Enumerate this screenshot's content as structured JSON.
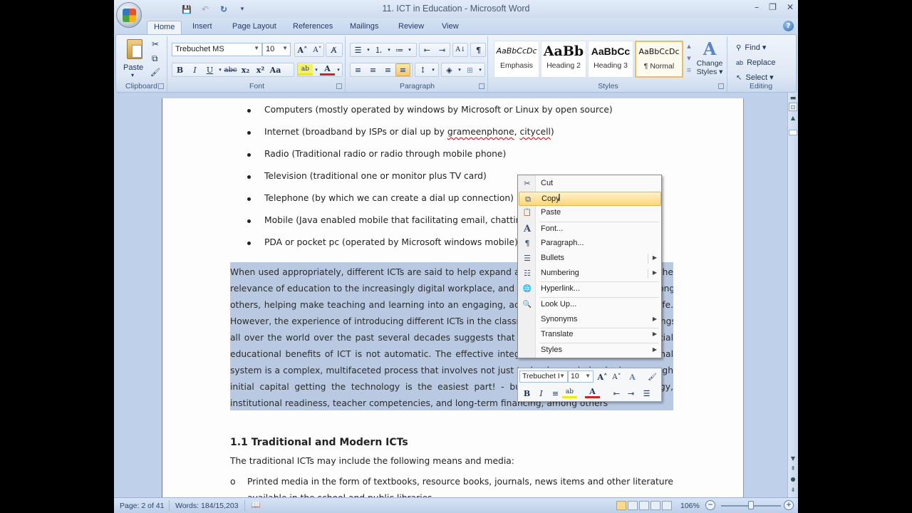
{
  "window": {
    "title": "11. ICT in Education - Microsoft Word",
    "controls": {
      "minimize": "–",
      "restore": "❐",
      "close": "✕"
    }
  },
  "quick_access": {
    "save": "💾",
    "undo": "↶",
    "redo": "↻",
    "customize": "▾"
  },
  "tabs": [
    {
      "label": "Home",
      "active": true
    },
    {
      "label": "Insert"
    },
    {
      "label": "Page Layout"
    },
    {
      "label": "References"
    },
    {
      "label": "Mailings"
    },
    {
      "label": "Review"
    },
    {
      "label": "View"
    }
  ],
  "help": "?",
  "ribbon": {
    "clipboard": {
      "label": "Clipboard",
      "paste": "Paste",
      "paste_arrow": "▾",
      "cut": "✂",
      "copy": "⧉",
      "format_painter": "🖌"
    },
    "font": {
      "label": "Font",
      "name": "Trebuchet MS",
      "size": "10",
      "grow": "A˄",
      "shrink": "A˅",
      "clear": "A̸",
      "bold": "B",
      "italic": "I",
      "underline": "U",
      "strike": "abc",
      "subscript": "x₂",
      "superscript": "x²",
      "case": "Aa",
      "highlight": "ab",
      "color": "A"
    },
    "paragraph": {
      "label": "Paragraph",
      "bullets": "☰",
      "numbering": "⒈",
      "multilevel": "≔",
      "decrease_indent": "⇤",
      "increase_indent": "⇥",
      "sort": "A↓",
      "show_marks": "¶",
      "align_left": "≡",
      "center": "≡",
      "align_right": "≡",
      "justify": "≡",
      "line_spacing": "↕",
      "shading": "◈",
      "borders": "⊞"
    },
    "styles": {
      "label": "Styles",
      "tiles": [
        {
          "preview": "AaBbCcDc",
          "name": "Emphasis"
        },
        {
          "preview": "AaBb",
          "name": "Heading 2"
        },
        {
          "preview": "AaBbCc",
          "name": "Heading 3"
        },
        {
          "preview": "AaBbCcDc",
          "name": "¶ Normal",
          "selected": true
        }
      ],
      "change_styles": "Change Styles ▾"
    },
    "editing": {
      "label": "Editing",
      "find": "Find ▾",
      "replace": "Replace",
      "select": "Select ▾"
    }
  },
  "document": {
    "bullets": [
      {
        "text": "Computers (mostly operated by windows by Microsoft or Linux by open source)"
      },
      {
        "pre": "Internet (broadband by ISPs or dial up by ",
        "w1": "grameenphone",
        "mid": ", ",
        "w2": "citycell",
        "post": ")"
      },
      {
        "text": "Radio (Traditional radio or radio through mobile phone)"
      },
      {
        "text": "Television (traditional one or monitor plus TV card)"
      },
      {
        "text": "Telephone (by which we can create a dial up connection)"
      },
      {
        "text": "Mobile (Java enabled mobile that facilitating email, chatting etc)"
      },
      {
        "text": "PDA or pocket pc (operated by Microsoft windows mobile)"
      }
    ],
    "paragraph_lines": [
      "When used appropriately, different ICTs are said to help expand access to education, strengthen the",
      "relevance of education to the increasingly digital workplace, and raise educational quality by, among",
      "others, helping make teaching and learning into an engaging, active process connected to real life.",
      "However, the experience of introducing different ICTs in the classroom and other educational settings",
      "all over the world over the past several decades suggests that the full realization of the potential",
      "educational benefits of ICT is not automatic. The effective integration of ICTs into the educational",
      "system is a complex, multifaceted process that involves not just technology -- indeed, given enough",
      "initial capital getting the technology is the easiest part! - but also curriculum and pedagogy,",
      "institutional readiness, teacher competencies, and long-term financing, among others."
    ],
    "heading": "1.1 Traditional and Modern ICTs",
    "intro": "The traditional ICTs may include the following means and media:",
    "sub_bullet_marker": "o",
    "sub_bullet": "Printed media in the form of textbooks, resource books, journals, news items and other literature",
    "sub_bullet_cont": "available in the school and public libraries"
  },
  "context_menu": {
    "items": [
      {
        "icon": "✂",
        "label": "Cut",
        "name": "cut"
      },
      {
        "icon": "⧉",
        "label": "Copy",
        "name": "copy",
        "hover": true
      },
      {
        "icon": "📋",
        "label": "Paste",
        "name": "paste"
      },
      {
        "icon": "A",
        "label": "Font...",
        "name": "font"
      },
      {
        "icon": "¶",
        "label": "Paragraph...",
        "name": "paragraph"
      },
      {
        "icon": "☰",
        "label": "Bullets",
        "name": "bullets",
        "submenu": true
      },
      {
        "icon": "☷",
        "label": "Numbering",
        "name": "numbering",
        "submenu": true
      },
      {
        "icon": "🌐",
        "label": "Hyperlink...",
        "name": "hyperlink"
      },
      {
        "icon": "🔍",
        "label": "Look Up...",
        "name": "look-up"
      },
      {
        "icon": "",
        "label": "Synonyms",
        "name": "synonyms",
        "submenu": true
      },
      {
        "icon": "",
        "label": "Translate",
        "name": "translate",
        "submenu": true
      },
      {
        "icon": "",
        "label": "Styles",
        "name": "styles",
        "submenu": true
      }
    ],
    "submenu_arrow": "▶"
  },
  "mini_toolbar": {
    "font": "Trebuchet I",
    "size": "10",
    "grow": "A˄",
    "shrink": "A˅",
    "styles": "A",
    "format_painter": "🖌",
    "bold": "B",
    "italic": "I",
    "center": "≡",
    "highlight": "ab",
    "color": "A",
    "decrease_indent": "⇤",
    "increase_indent": "⇥",
    "bullets": "☰"
  },
  "status_bar": {
    "page": "Page: 2 of 41",
    "words": "Words: 184/15,203",
    "proofing": "📖",
    "zoom": "106%",
    "zoom_out": "−",
    "zoom_in": "+"
  },
  "scrollbar": {
    "up": "▲",
    "down": "▼",
    "prev": "⇞",
    "browse": "●",
    "next": "⇟",
    "split": "▬"
  },
  "colors": {
    "selection": "#b9c9e2",
    "ribbon": "#dfe8f5",
    "menu_hover": "#fbd779",
    "accent": "#2c66b3"
  }
}
